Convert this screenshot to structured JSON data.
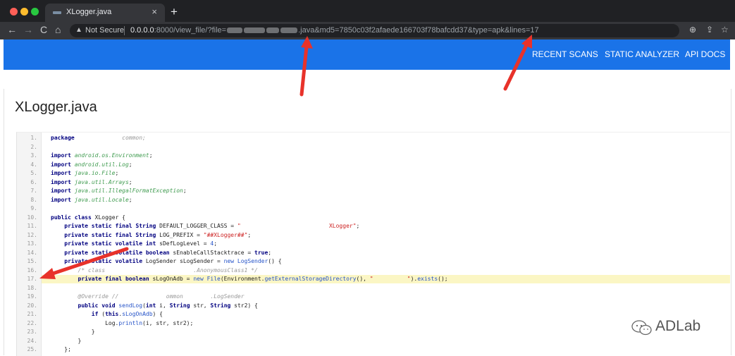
{
  "browser": {
    "tab_title": "XLogger.java",
    "close_glyph": "×",
    "newtab_glyph": "+",
    "nav": {
      "back": "←",
      "forward": "→",
      "reload": "C",
      "home": "⌂"
    },
    "security_icon": "▲",
    "security_label": "Not Secure",
    "url_host": "0.0.0.0",
    "url_port_path": ":8000/view_file/?file=",
    "url_suffix": ".java&md5=7850c03f2afaede166703f78bafcdd37&type=apk&lines=17",
    "toolbar_icons": {
      "zoom": "⊕",
      "share": "⇪",
      "star": "☆"
    }
  },
  "site_nav": {
    "items": [
      "RECENT SCANS",
      "STATIC ANALYZER",
      "API DOCS"
    ]
  },
  "page": {
    "title": "XLogger.java"
  },
  "code": {
    "highlighted_line": 17,
    "line_numbers": [
      "1.",
      "2.",
      "3.",
      "4.",
      "5.",
      "6.",
      "7.",
      "8.",
      "9.",
      "10.",
      "11.",
      "12.",
      "13.",
      "14.",
      "15.",
      "16.",
      "17.",
      "18.",
      "19.",
      "20.",
      "21.",
      "22.",
      "23.",
      "24.",
      "25."
    ],
    "lines": [
      [
        {
          "t": "package",
          "c": "kw"
        },
        {
          "t": "              ",
          "c": "pl"
        },
        {
          "t": "common;",
          "c": "cm"
        }
      ],
      [],
      [
        {
          "t": "import",
          "c": "kw"
        },
        {
          "t": " ",
          "c": "pl"
        },
        {
          "t": "android.os.Environment",
          "c": "pk"
        },
        {
          "t": ";",
          "c": "pl"
        }
      ],
      [
        {
          "t": "import",
          "c": "kw"
        },
        {
          "t": " ",
          "c": "pl"
        },
        {
          "t": "android.util.Log",
          "c": "pk"
        },
        {
          "t": ";",
          "c": "pl"
        }
      ],
      [
        {
          "t": "import",
          "c": "kw"
        },
        {
          "t": " ",
          "c": "pl"
        },
        {
          "t": "java.io.File",
          "c": "pk"
        },
        {
          "t": ";",
          "c": "pl"
        }
      ],
      [
        {
          "t": "import",
          "c": "kw"
        },
        {
          "t": " ",
          "c": "pl"
        },
        {
          "t": "java.util.Arrays",
          "c": "pk"
        },
        {
          "t": ";",
          "c": "pl"
        }
      ],
      [
        {
          "t": "import",
          "c": "kw"
        },
        {
          "t": " ",
          "c": "pl"
        },
        {
          "t": "java.util.IllegalFormatException",
          "c": "pk"
        },
        {
          "t": ";",
          "c": "pl"
        }
      ],
      [
        {
          "t": "import",
          "c": "kw"
        },
        {
          "t": " ",
          "c": "pl"
        },
        {
          "t": "java.util.Locale",
          "c": "pk"
        },
        {
          "t": ";",
          "c": "pl"
        }
      ],
      [],
      [
        {
          "t": "public",
          "c": "kw"
        },
        {
          "t": " ",
          "c": "pl"
        },
        {
          "t": "class",
          "c": "kw"
        },
        {
          "t": " XLogger {",
          "c": "pl"
        }
      ],
      [
        {
          "t": "    ",
          "c": "pl"
        },
        {
          "t": "private static final",
          "c": "kw"
        },
        {
          "t": " ",
          "c": "pl"
        },
        {
          "t": "String",
          "c": "kw"
        },
        {
          "t": " DEFAULT_LOGGER_CLASS = ",
          "c": "pl"
        },
        {
          "t": "\"",
          "c": "st"
        },
        {
          "t": "                          ",
          "c": "pl"
        },
        {
          "t": "XLogger\"",
          "c": "st"
        },
        {
          "t": ";",
          "c": "pl"
        }
      ],
      [
        {
          "t": "    ",
          "c": "pl"
        },
        {
          "t": "private static final",
          "c": "kw"
        },
        {
          "t": " ",
          "c": "pl"
        },
        {
          "t": "String",
          "c": "kw"
        },
        {
          "t": " LOG_PREFIX = ",
          "c": "pl"
        },
        {
          "t": "\"##XLogger##\"",
          "c": "st"
        },
        {
          "t": ";",
          "c": "pl"
        }
      ],
      [
        {
          "t": "    ",
          "c": "pl"
        },
        {
          "t": "private static volatile int",
          "c": "kw"
        },
        {
          "t": " sDefLogLevel = ",
          "c": "pl"
        },
        {
          "t": "4",
          "c": "nm"
        },
        {
          "t": ";",
          "c": "pl"
        }
      ],
      [
        {
          "t": "    ",
          "c": "pl"
        },
        {
          "t": "private static volatile boolean",
          "c": "kw"
        },
        {
          "t": " sEnableCallStacktrace = ",
          "c": "pl"
        },
        {
          "t": "true",
          "c": "kw"
        },
        {
          "t": ";",
          "c": "pl"
        }
      ],
      [
        {
          "t": "    ",
          "c": "pl"
        },
        {
          "t": "private static volatile",
          "c": "kw"
        },
        {
          "t": " LogSender sLogSender = ",
          "c": "pl"
        },
        {
          "t": "new",
          "c": "nm"
        },
        {
          "t": " ",
          "c": "pl"
        },
        {
          "t": "LogSender",
          "c": "nm"
        },
        {
          "t": "() {",
          "c": "pl"
        }
      ],
      [
        {
          "t": "        ",
          "c": "pl"
        },
        {
          "t": "/* class                          .AnonymousClass1 */",
          "c": "cm"
        }
      ],
      [
        {
          "t": "        ",
          "c": "pl"
        },
        {
          "t": "private final boolean",
          "c": "kw"
        },
        {
          "t": " sLogOnAdb = ",
          "c": "pl"
        },
        {
          "t": "new",
          "c": "nm"
        },
        {
          "t": " ",
          "c": "pl"
        },
        {
          "t": "File",
          "c": "nm"
        },
        {
          "t": "(Environment.",
          "c": "pl"
        },
        {
          "t": "getExternalStorageDirectory",
          "c": "nm"
        },
        {
          "t": "(), ",
          "c": "pl"
        },
        {
          "t": "\"          \"",
          "c": "st"
        },
        {
          "t": ").",
          "c": "pl"
        },
        {
          "t": "exists",
          "c": "nm"
        },
        {
          "t": "();",
          "c": "pl"
        }
      ],
      [],
      [
        {
          "t": "        ",
          "c": "pl"
        },
        {
          "t": "@Override //              ommon        .LogSender",
          "c": "cm"
        }
      ],
      [
        {
          "t": "        ",
          "c": "pl"
        },
        {
          "t": "public void",
          "c": "kw"
        },
        {
          "t": " ",
          "c": "pl"
        },
        {
          "t": "sendLog",
          "c": "nm"
        },
        {
          "t": "(",
          "c": "pl"
        },
        {
          "t": "int",
          "c": "kw"
        },
        {
          "t": " i, ",
          "c": "pl"
        },
        {
          "t": "String",
          "c": "kw"
        },
        {
          "t": " str, ",
          "c": "pl"
        },
        {
          "t": "String",
          "c": "kw"
        },
        {
          "t": " str2) {",
          "c": "pl"
        }
      ],
      [
        {
          "t": "            ",
          "c": "pl"
        },
        {
          "t": "if",
          "c": "kw"
        },
        {
          "t": " (",
          "c": "pl"
        },
        {
          "t": "this",
          "c": "kw"
        },
        {
          "t": ".",
          "c": "pl"
        },
        {
          "t": "sLogOnAdb",
          "c": "nm"
        },
        {
          "t": ") {",
          "c": "pl"
        }
      ],
      [
        {
          "t": "                Log.",
          "c": "pl"
        },
        {
          "t": "println",
          "c": "nm"
        },
        {
          "t": "(i, str, str2);",
          "c": "pl"
        }
      ],
      [
        {
          "t": "            }",
          "c": "pl"
        }
      ],
      [
        {
          "t": "        }",
          "c": "pl"
        }
      ],
      [
        {
          "t": "    };",
          "c": "pl"
        }
      ]
    ]
  },
  "watermark": {
    "text": "ADLab"
  },
  "colors": {
    "tabbar": "#202124",
    "toolbar": "#35363a",
    "site_nav": "#1a73e8",
    "highlight": "#fbf6c4",
    "annotation_arrow": "#e8322a"
  }
}
